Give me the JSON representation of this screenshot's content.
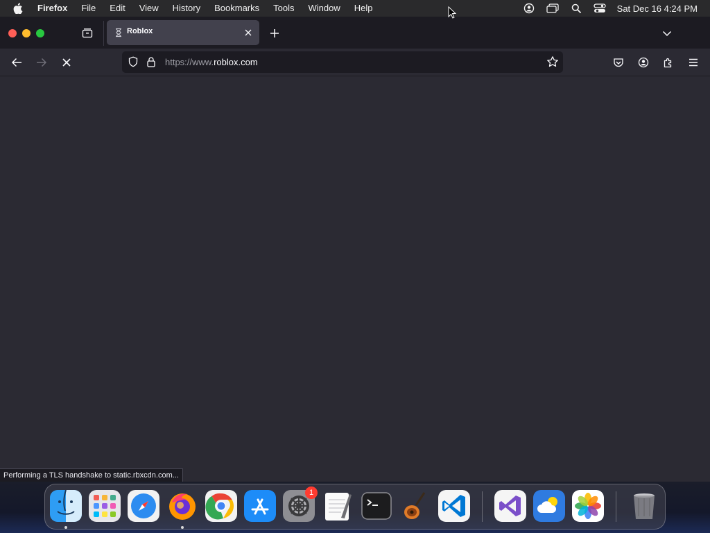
{
  "menubar": {
    "app_name": "Firefox",
    "items": [
      "File",
      "Edit",
      "View",
      "History",
      "Bookmarks",
      "Tools",
      "Window",
      "Help"
    ],
    "clock": "Sat Dec 16  4:24 PM"
  },
  "tab": {
    "title": "Roblox"
  },
  "urlbar": {
    "url_prefix": "https://www.",
    "url_domain": "roblox.com"
  },
  "status": {
    "text": "Performing a TLS handshake to static.rbxcdn.com..."
  },
  "dock": {
    "apps": [
      "Finder",
      "Launchpad",
      "Safari",
      "Firefox",
      "Google Chrome",
      "App Store",
      "System Settings",
      "TextEdit",
      "Terminal",
      "GarageBand",
      "Visual Studio Code",
      "Visual Studio",
      "Weather",
      "Photos",
      "Trash"
    ],
    "settings_badge": "1"
  },
  "colors": {
    "toolbar": "#2b2a33",
    "tabbar": "#1c1b22",
    "tab_selected": "#42414d",
    "menubar": "#2a2a2c"
  }
}
